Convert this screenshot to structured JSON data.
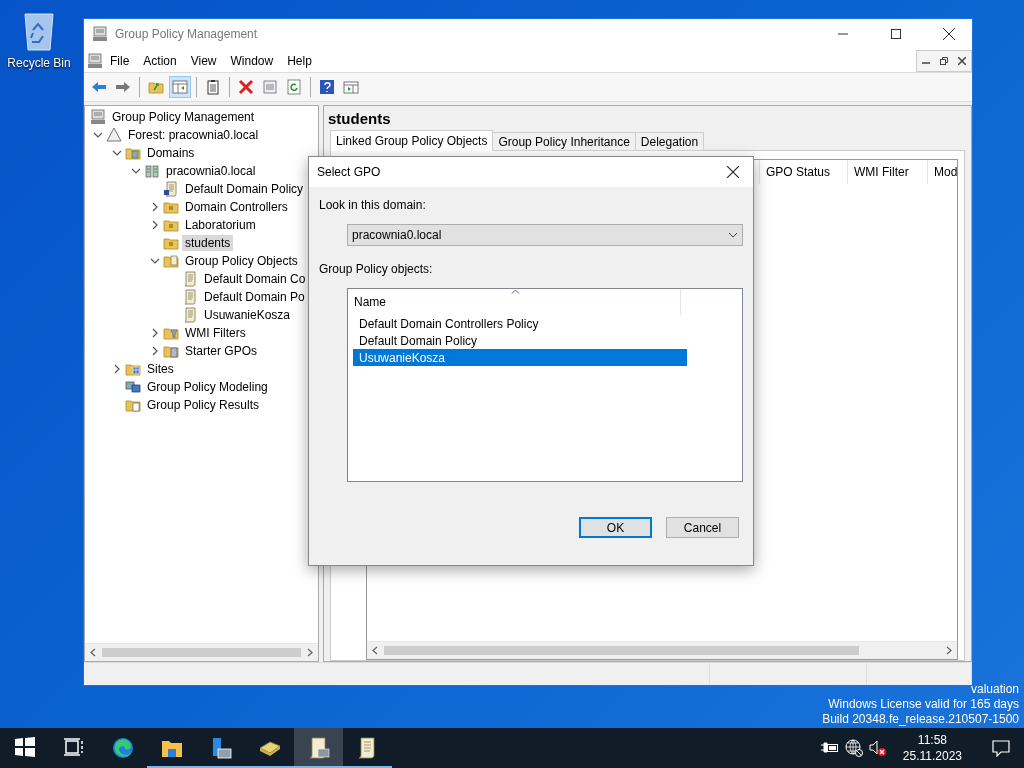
{
  "desktop": {
    "icons": [
      {
        "label": "Recycle Bin",
        "kind": "recycle-bin"
      }
    ],
    "watermark": [
      "valuation",
      "Windows License valid for 165 days",
      "Build 20348.fe_release.210507-1500"
    ]
  },
  "window": {
    "title": "Group Policy Management",
    "menu": [
      "File",
      "Action",
      "View",
      "Window",
      "Help"
    ],
    "toolbar": [
      {
        "kind": "back",
        "pressed": false
      },
      {
        "kind": "forward",
        "pressed": false
      },
      {
        "kind": "separator"
      },
      {
        "kind": "up",
        "pressed": false
      },
      {
        "kind": "tree",
        "pressed": true
      },
      {
        "kind": "separator"
      },
      {
        "kind": "export",
        "pressed": false
      },
      {
        "kind": "separator"
      },
      {
        "kind": "delete",
        "pressed": false
      },
      {
        "kind": "properties",
        "pressed": false
      },
      {
        "kind": "refresh",
        "pressed": false
      },
      {
        "kind": "separator"
      },
      {
        "kind": "help",
        "pressed": false
      },
      {
        "kind": "action-pane",
        "pressed": false
      }
    ],
    "tree": [
      {
        "label": "Group Policy Management",
        "kind": "console",
        "selected": false,
        "children": [
          {
            "label": "Forest: pracownia0.local",
            "kind": "forest",
            "expanded": true,
            "selected": false,
            "children": [
              {
                "label": "Domains",
                "kind": "domains",
                "expanded": true,
                "selected": false,
                "children": [
                  {
                    "label": "pracownia0.local",
                    "kind": "domain",
                    "expanded": true,
                    "selected": false,
                    "children": [
                      {
                        "label": "Default Domain Policy",
                        "kind": "gpo-link",
                        "selected": false
                      },
                      {
                        "label": "Domain Controllers",
                        "kind": "ou",
                        "expanded": false,
                        "selected": false
                      },
                      {
                        "label": "Laboratorium",
                        "kind": "ou",
                        "expanded": false,
                        "selected": false
                      },
                      {
                        "label": "students",
                        "kind": "ou",
                        "selected": true
                      },
                      {
                        "label": "Group Policy Objects",
                        "kind": "gpo-container",
                        "expanded": true,
                        "selected": false,
                        "children": [
                          {
                            "label": "Default Domain Co",
                            "kind": "gpo",
                            "selected": false
                          },
                          {
                            "label": "Default Domain Po",
                            "kind": "gpo",
                            "selected": false
                          },
                          {
                            "label": "UsuwanieKosza",
                            "kind": "gpo",
                            "selected": false
                          }
                        ]
                      },
                      {
                        "label": "WMI Filters",
                        "kind": "wmi",
                        "expanded": false,
                        "selected": false
                      },
                      {
                        "label": "Starter GPOs",
                        "kind": "starter",
                        "expanded": false,
                        "selected": false
                      }
                    ]
                  }
                ]
              },
              {
                "label": "Sites",
                "kind": "sites",
                "expanded": false,
                "selected": false
              },
              {
                "label": "Group Policy Modeling",
                "kind": "modeling",
                "selected": false
              },
              {
                "label": "Group Policy Results",
                "kind": "results",
                "selected": false
              }
            ]
          }
        ]
      }
    ],
    "panel": {
      "title": "students",
      "tabs": [
        {
          "label": "Linked Group Policy Objects",
          "selected": true
        },
        {
          "label": "Group Policy Inheritance",
          "selected": false
        },
        {
          "label": "Delegation",
          "selected": false
        }
      ],
      "columns": [
        "GPO Status",
        "WMI Filter",
        "Mod"
      ]
    }
  },
  "dialog": {
    "title": "Select GPO",
    "domain_label": "Look in this domain:",
    "domain": "pracownia0.local",
    "objects_label": "Group Policy objects:",
    "column": "Name",
    "rows": [
      {
        "name": "Default Domain Controllers Policy",
        "selected": false
      },
      {
        "name": "Default Domain Policy",
        "selected": false
      },
      {
        "name": "UsuwanieKosza",
        "selected": true
      }
    ],
    "buttons": [
      {
        "label": "OK",
        "default": true
      },
      {
        "label": "Cancel",
        "default": false
      }
    ]
  },
  "taskbar": {
    "apps": [
      {
        "kind": "start",
        "running": false,
        "active": false
      },
      {
        "kind": "task-view",
        "running": false,
        "active": false
      },
      {
        "kind": "browser",
        "running": false,
        "active": false
      },
      {
        "kind": "folder",
        "running": true,
        "active": false
      },
      {
        "kind": "server",
        "running": true,
        "active": false
      },
      {
        "kind": "book",
        "running": true,
        "active": false
      },
      {
        "kind": "scroll-computer",
        "running": true,
        "active": true
      },
      {
        "kind": "scroll",
        "running": true,
        "active": false
      }
    ],
    "clock": {
      "time": "11:58",
      "date": "25.11.2023"
    }
  }
}
